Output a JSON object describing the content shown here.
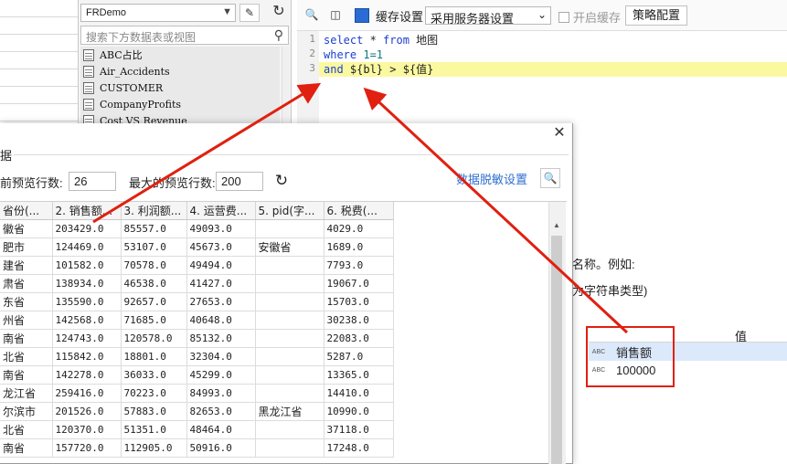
{
  "dataset_panel": {
    "connection": "FRDemo",
    "search_placeholder": "搜索下方数据表或视图",
    "tables": [
      "ABC占比",
      "Air_Accidents",
      "CUSTOMER",
      "CompanyProfits",
      "Cost VS Revenue"
    ]
  },
  "sql_toolbar": {
    "cache_label": "缓存设置",
    "cache_option": "采用服务器设置",
    "enable_cache": "开启缓存",
    "strategy": "策略配置"
  },
  "sql": {
    "line_numbers": [
      "1",
      "2",
      "3"
    ],
    "line1": {
      "kw1": "select",
      "rest": " * ",
      "kw2": "from",
      "table": " 地图"
    },
    "line2": {
      "kw": "where",
      "num": " 1=1"
    },
    "line3": {
      "kw": "and",
      "rest": " ${bl} > ${值}"
    }
  },
  "params": {
    "hint1": "名称。例如:",
    "hint2": "为字符串类型)",
    "header_value": "值",
    "rows": [
      {
        "type_icon": "ABC",
        "value": "销售额"
      },
      {
        "type_icon": "ABC",
        "value": "100000"
      }
    ]
  },
  "dialog": {
    "group_label": "据",
    "preview_count_label": "前预览行数:",
    "preview_count": "26",
    "max_count_label": "最大的预览行数:",
    "max_count": "200",
    "desensitize_link": "数据脱敏设置",
    "columns": [
      "省份(...",
      "2. 销售额...",
      "3. 利润额...",
      "4. 运营费...",
      "5. pid(字...",
      "6. 税费(..."
    ],
    "rows": [
      [
        "徽省",
        "203429.0",
        "85557.0",
        "49093.0",
        "",
        "4029.0"
      ],
      [
        "肥市",
        "124469.0",
        "53107.0",
        "45673.0",
        "安徽省",
        "1689.0"
      ],
      [
        "建省",
        "101582.0",
        "70578.0",
        "49494.0",
        "",
        "7793.0"
      ],
      [
        "肃省",
        "138934.0",
        "46538.0",
        "41427.0",
        "",
        "19067.0"
      ],
      [
        "东省",
        "135590.0",
        "92657.0",
        "27653.0",
        "",
        "15703.0"
      ],
      [
        "州省",
        "142568.0",
        "71685.0",
        "40648.0",
        "",
        "30238.0"
      ],
      [
        "南省",
        "124743.0",
        "120578.0",
        "85132.0",
        "",
        "22083.0"
      ],
      [
        "北省",
        "115842.0",
        "18801.0",
        "32304.0",
        "",
        "5287.0"
      ],
      [
        "南省",
        "142278.0",
        "36033.0",
        "45299.0",
        "",
        "13365.0"
      ],
      [
        "龙江省",
        "259416.0",
        "70223.0",
        "84993.0",
        "",
        "14410.0"
      ],
      [
        "尔滨市",
        "201526.0",
        "57883.0",
        "82653.0",
        "黑龙江省",
        "10990.0"
      ],
      [
        "北省",
        "120370.0",
        "51351.0",
        "48464.0",
        "",
        "37118.0"
      ],
      [
        "南省",
        "157720.0",
        "112905.0",
        "50916.0",
        "",
        "17248.0"
      ]
    ]
  },
  "annotation_color": "#e02010"
}
